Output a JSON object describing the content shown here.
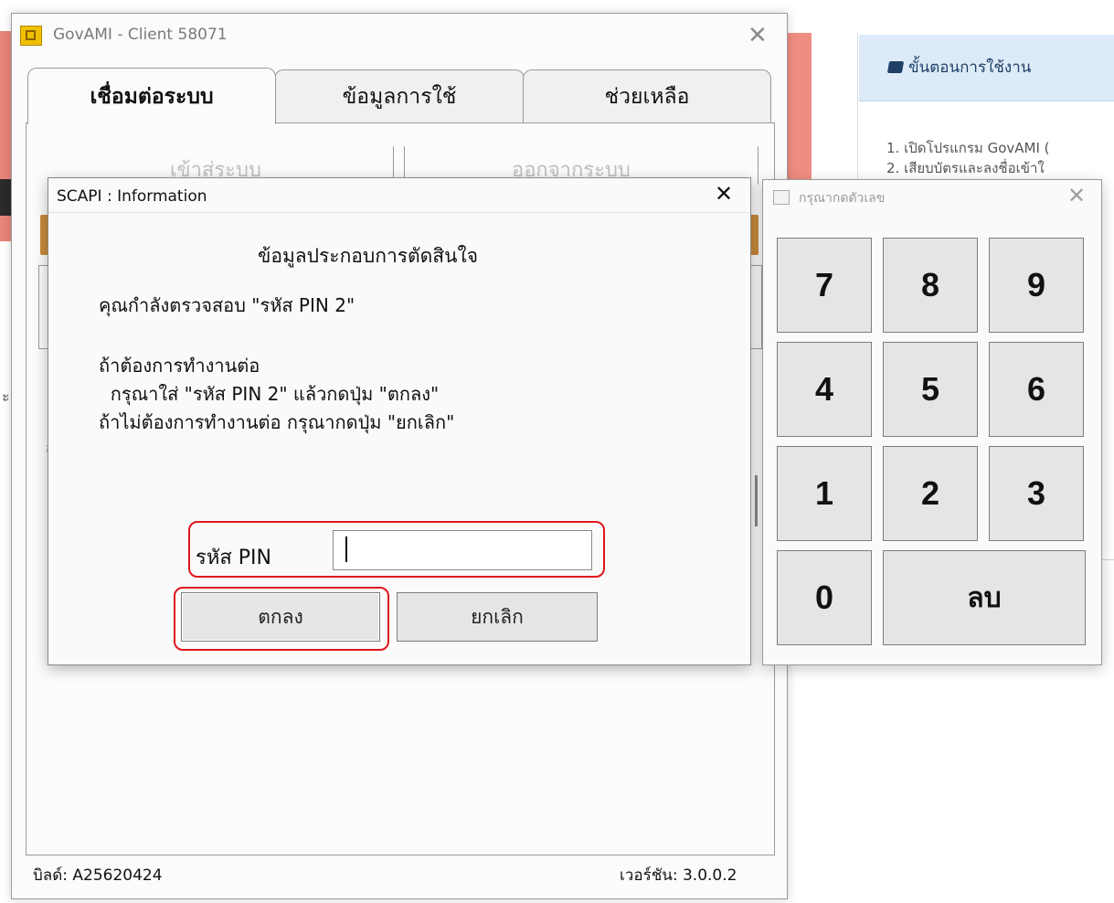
{
  "background": {
    "panel_title": "ขั้นตอนการใช้งาน",
    "steps": [
      "1. เปิดโปรแกรม GovAMI (",
      "2. เสียบบัตรและลงชื่อเข้าใ"
    ],
    "side_text": [
      "ะ",
      "อ"
    ]
  },
  "govami": {
    "title": "GovAMI - Client 58071",
    "close": "✕",
    "tabs": [
      "เชื่อมต่อระบบ",
      "ข้อมูลการใช้",
      "ช่วยเหลือ"
    ],
    "ghost_buttons": [
      "เข้าสู่ระบบ",
      "ออกจากระบบ"
    ],
    "build": "บิลด์: A25620424",
    "version": "เวอร์ชัน: 3.0.0.2"
  },
  "scapi": {
    "title": "SCAPI : Information",
    "close": "✕",
    "heading": "ข้อมูลประกอบการตัดสินใจ",
    "line1": "คุณกำลังตรวจสอบ \"รหัส PIN 2\"",
    "line2": "ถ้าต้องการทำงานต่อ",
    "line3": "  กรุณาใส่ \"รหัส PIN 2\" แล้วกดปุ่ม \"ตกลง\"",
    "line4": "ถ้าไม่ต้องการทำงานต่อ กรุณากดปุ่ม \"ยกเลิก\"",
    "pin_label": "รหัส PIN",
    "pin_value": "",
    "ok_label": "ตกลง",
    "cancel_label": "ยกเลิก"
  },
  "keypad": {
    "title": "กรุณากดตัวเลข",
    "close": "✕",
    "keys": [
      "7",
      "8",
      "9",
      "4",
      "5",
      "6",
      "1",
      "2",
      "3",
      "0",
      "ลบ"
    ]
  },
  "colors": {
    "highlight": "#e0161c",
    "orange_bar": "#c98a3a",
    "panel_header": "#dcebf7"
  }
}
